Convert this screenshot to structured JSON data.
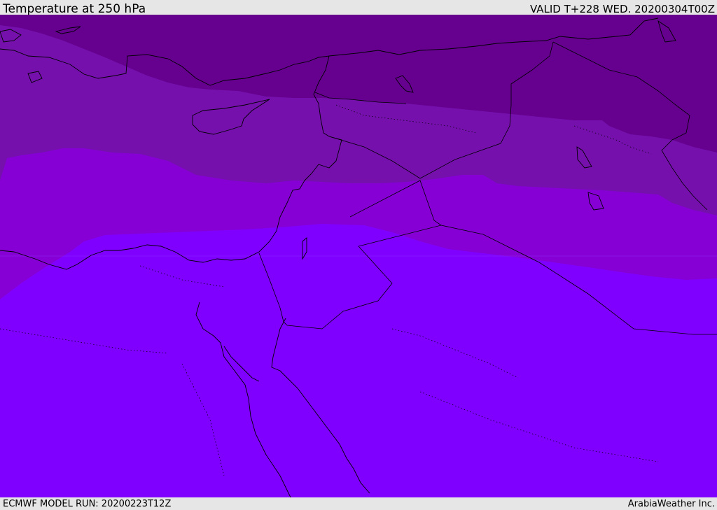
{
  "header": {
    "title": "Temperature at 250 hPa",
    "valid": "VALID T+228 WED. 20200304T00Z"
  },
  "footer": {
    "model_run": "ECMWF MODEL RUN: 20200223T12Z",
    "brand": "ArabiaWeather Inc."
  },
  "colors": {
    "band_coldest": "#65008f",
    "band_cold": "#7510ad",
    "band_mid": "#8600d6",
    "band_warm": "#7f00ff",
    "coastline": "#000000",
    "frame": "#e6e6e6"
  }
}
